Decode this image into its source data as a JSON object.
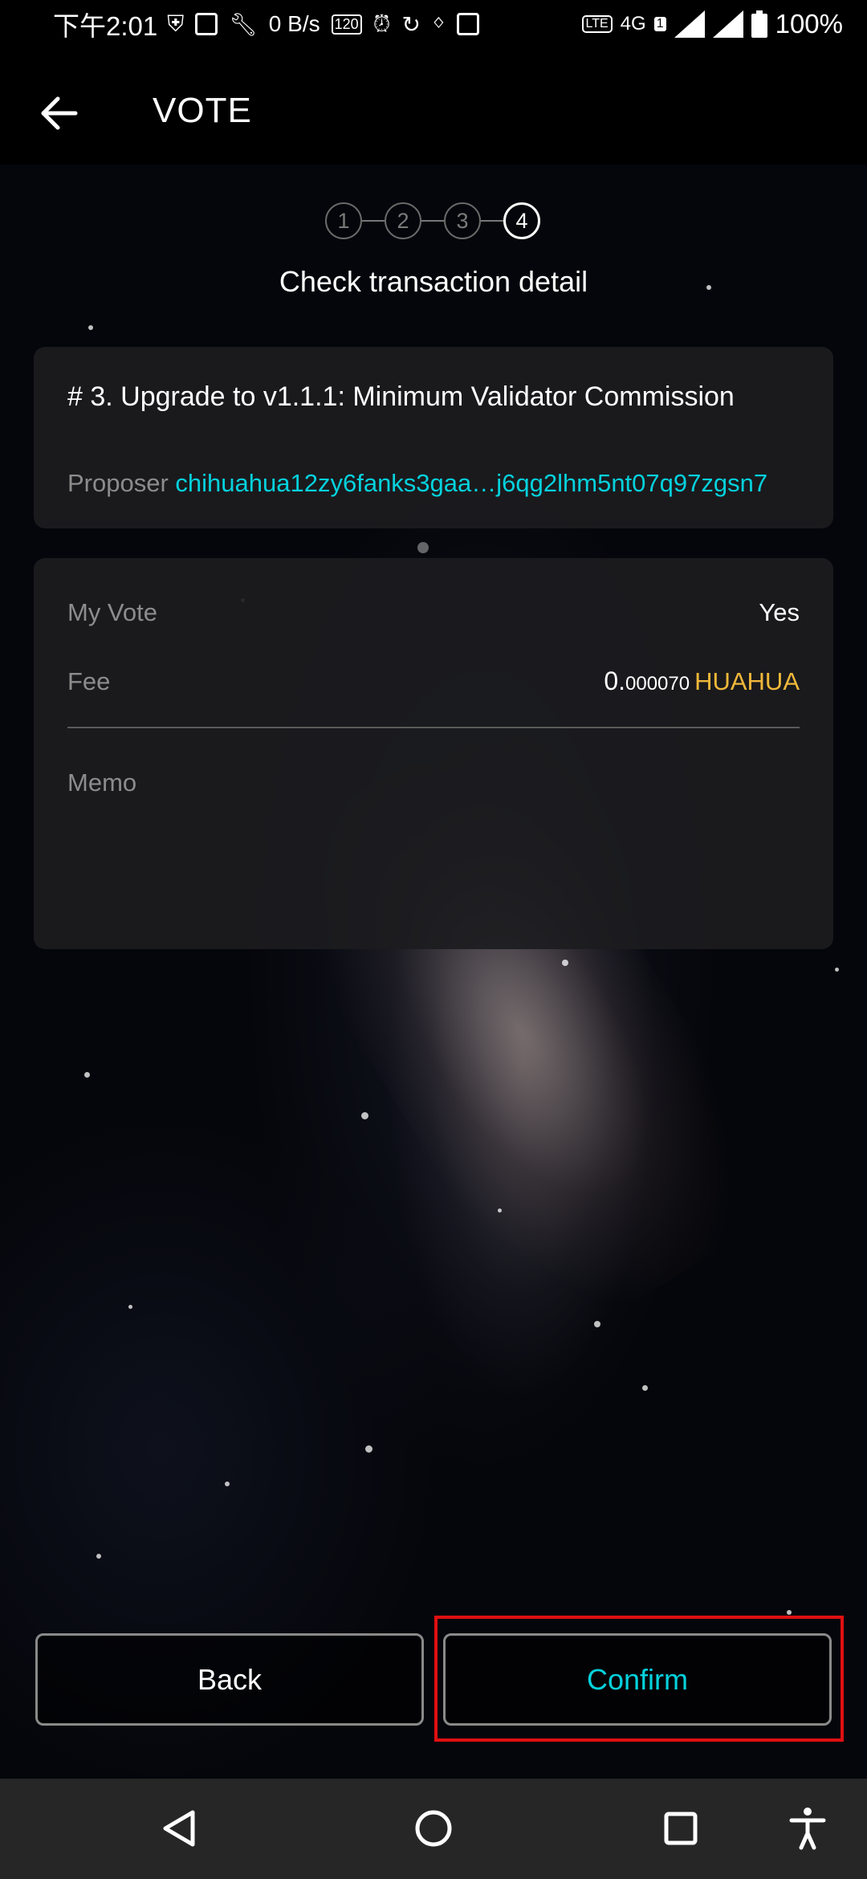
{
  "status_bar": {
    "time": "下午2:01",
    "net_speed": "0 B/s",
    "refresh_rate": "120",
    "network": "4G",
    "sim_badge": "1",
    "battery": "100%"
  },
  "header": {
    "title": "VOTE"
  },
  "stepper": {
    "steps": [
      "1",
      "2",
      "3",
      "4"
    ],
    "active_step": 4,
    "subtitle": "Check transaction detail"
  },
  "proposal": {
    "title": "# 3. Upgrade to v1.1.1: Minimum Validator Commission",
    "proposer_label": "Proposer",
    "proposer_address": "chihuahua12zy6fanks3gaa…j6qg2lhm5nt07q97zgsn7"
  },
  "details": {
    "vote_label": "My Vote",
    "vote_value": "Yes",
    "fee_label": "Fee",
    "fee_integer": "0.",
    "fee_decimal": "000070",
    "fee_denom": "HUAHUA",
    "memo_label": "Memo"
  },
  "buttons": {
    "back_label": "Back",
    "confirm_label": "Confirm"
  },
  "colors": {
    "accent": "#05d2dd",
    "denom": "#f0b83a",
    "highlight": "#e01010"
  }
}
